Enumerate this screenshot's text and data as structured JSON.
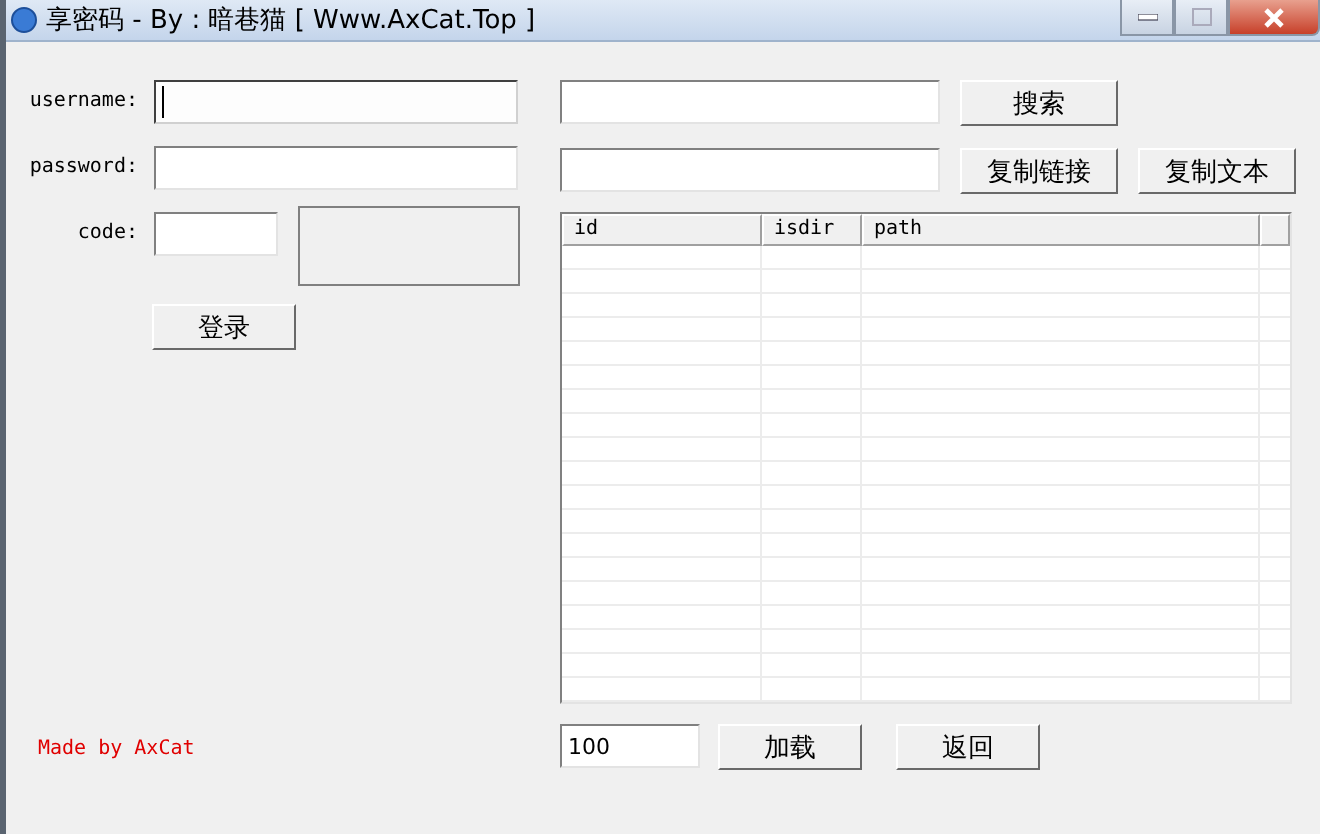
{
  "window": {
    "title": "享密码 - By : 暗巷猫 [ Www.AxCat.Top ]"
  },
  "login": {
    "fields": [
      {
        "label": "username:",
        "focused": true
      },
      {
        "label": "password:",
        "focused": false
      }
    ],
    "code": {
      "label": "code:"
    },
    "button": "登录"
  },
  "search": {
    "button": "搜索"
  },
  "link": {
    "buttons": [
      "复制链接",
      "复制文本"
    ]
  },
  "table": {
    "columns": [
      "id",
      "isdir",
      "path"
    ]
  },
  "footer": {
    "credit": "Made by AxCat",
    "page_value": "100",
    "buttons": [
      "加载",
      "返回"
    ]
  }
}
